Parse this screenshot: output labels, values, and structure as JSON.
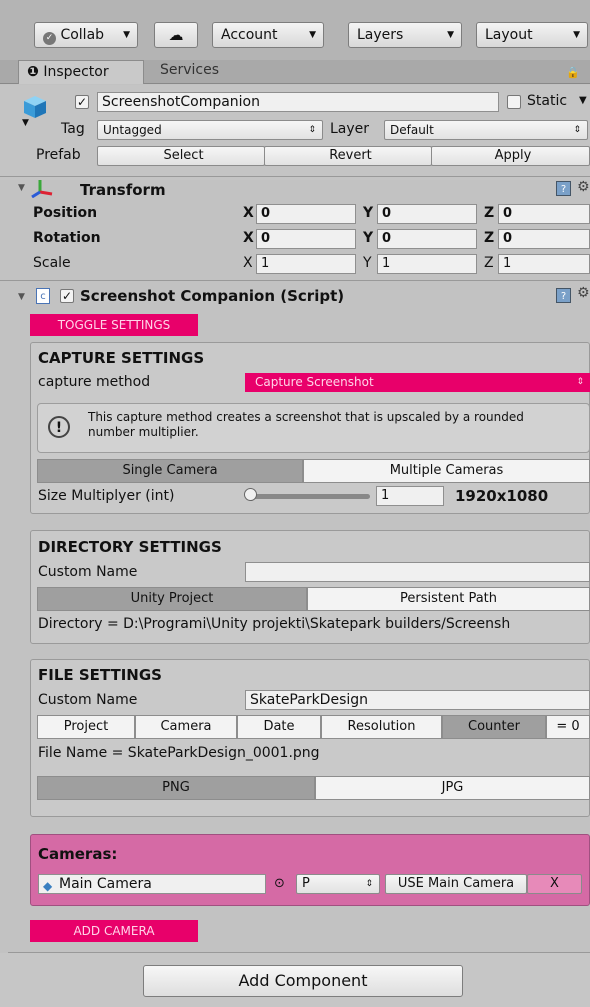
{
  "toolbar": {
    "collab_label": "Collab",
    "account_label": "Account",
    "layers_label": "Layers",
    "layout_label": "Layout"
  },
  "tabs": {
    "inspector_label": "Inspector",
    "services_label": "Services"
  },
  "object": {
    "name": "ScreenshotCompanion",
    "static_label": "Static",
    "tag_label": "Tag",
    "tag_value": "Untagged",
    "layer_label": "Layer",
    "layer_value": "Default",
    "prefab_label": "Prefab",
    "prefab_select": "Select",
    "prefab_revert": "Revert",
    "prefab_apply": "Apply"
  },
  "transform": {
    "title": "Transform",
    "position_label": "Position",
    "rotation_label": "Rotation",
    "scale_label": "Scale",
    "x_label": "X",
    "y_label": "Y",
    "z_label": "Z",
    "position": {
      "x": "0",
      "y": "0",
      "z": "0"
    },
    "rotation": {
      "x": "0",
      "y": "0",
      "z": "0"
    },
    "scale": {
      "x": "1",
      "y": "1",
      "z": "1"
    }
  },
  "script": {
    "title": "Screenshot Companion (Script)",
    "toggle_settings": "TOGGLE SETTINGS"
  },
  "capture": {
    "title": "CAPTURE SETTINGS",
    "method_label": "capture method",
    "method_value": "Capture Screenshot",
    "info_text": "This capture method creates a screenshot that is upscaled by a rounded number multiplier.",
    "single_camera": "Single Camera",
    "multiple_cameras": "Multiple Cameras",
    "multiplier_label": "Size Multiplyer (int)",
    "multiplier_value": "1",
    "multiplier_fraction": 0,
    "resolution": "1920x1080"
  },
  "directory": {
    "title": "DIRECTORY SETTINGS",
    "custom_name_label": "Custom Name",
    "custom_name_value": "",
    "unity_project": "Unity Project",
    "persistent_path": "Persistent Path",
    "directory_text": "Directory = D:\\Programi\\Unity projekti\\Skatepark builders/Screensh"
  },
  "file": {
    "title": "FILE SETTINGS",
    "custom_name_label": "Custom Name",
    "custom_name_value": "SkateParkDesign",
    "opt_project": "Project",
    "opt_camera": "Camera",
    "opt_date": "Date",
    "opt_resolution": "Resolution",
    "opt_counter": "Counter",
    "counter_value": "= 0",
    "file_name": "File Name = SkateParkDesign_0001.png",
    "png": "PNG",
    "jpg": "JPG"
  },
  "cameras": {
    "title": "Cameras:",
    "camera_name": "Main Camera",
    "mode_value": "P",
    "use_label": "USE Main Camera",
    "remove_label": "X",
    "add_camera": "ADD CAMERA"
  },
  "add_component": "Add Component",
  "colors": {
    "accent_pink": "#e8006a",
    "cameras_panel": "#d56aa5"
  }
}
